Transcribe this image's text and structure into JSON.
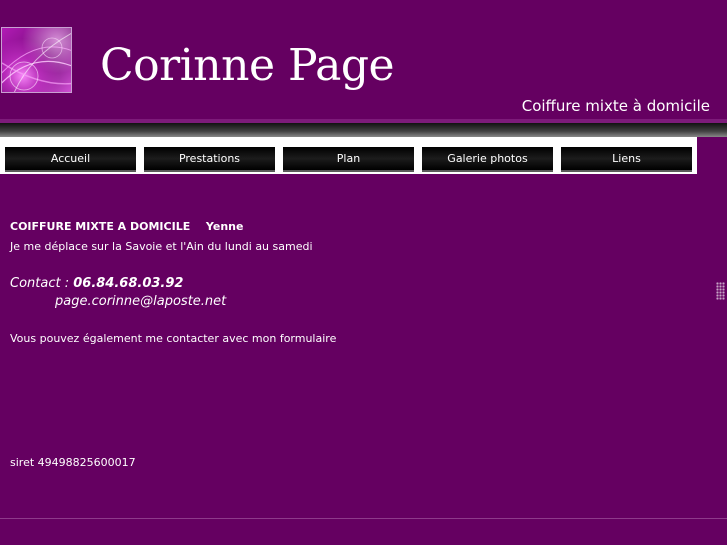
{
  "header": {
    "title": "Corinne Page",
    "tagline": "Coiffure mixte à domicile"
  },
  "menu": [
    {
      "label": "Accueil"
    },
    {
      "label": "Prestations"
    },
    {
      "label": "Plan"
    },
    {
      "label": "Galerie photos"
    },
    {
      "label": "Liens"
    }
  ],
  "content": {
    "heading": "COIFFURE MIXTE A DOMICILE",
    "city": "Yenne",
    "description": "Je me déplace sur la Savoie et l'Ain  du lundi au samedi",
    "contact_label": "Contact : ",
    "phone": "06.84.68.03.92",
    "email": "page.corinne@laposte.net",
    "form_text": "Vous pouvez également me contacter avec mon formulaire",
    "siret": "siret 49498825600017"
  },
  "colors": {
    "background": "#650061",
    "menu_button": "#000000",
    "text": "#ffffff"
  }
}
